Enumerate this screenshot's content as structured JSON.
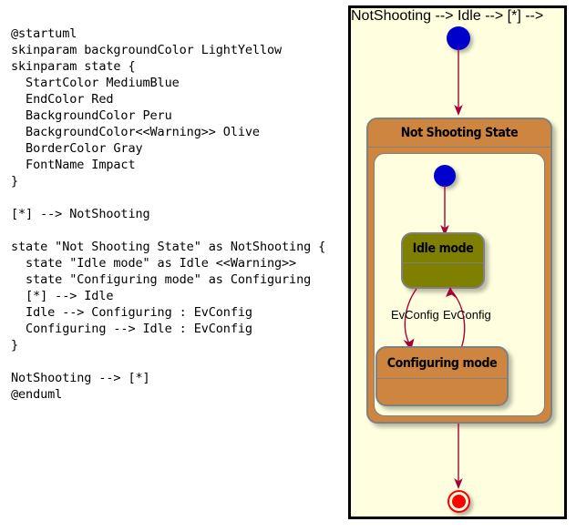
{
  "source": {
    "language": "plantuml",
    "code": "@startuml\nskinparam backgroundColor LightYellow\nskinparam state {\n  StartColor MediumBlue\n  EndColor Red\n  BackgroundColor Peru\n  BackgroundColor<<Warning>> Olive\n  BorderColor Gray\n  FontName Impact\n}\n\n[*] --> NotShooting\n\nstate \"Not Shooting State\" as NotShooting {\n  state \"Idle mode\" as Idle <<Warning>>\n  state \"Configuring mode\" as Configuring\n  [*] --> Idle\n  Idle --> Configuring : EvConfig\n  Configuring --> Idle : EvConfig\n}\n\nNotShooting --> [*]\n@enduml"
  },
  "diagram": {
    "type": "state-diagram",
    "background_color": "#FFFFE0",
    "border_color": "#000000",
    "colors": {
      "start": "#0000CD",
      "end": "#FF0000",
      "state_background": "#CD853F",
      "state_background_warning": "#808000",
      "state_border": "#808080",
      "arrow": "#A80036",
      "font": "Impact"
    },
    "nodes": {
      "start_outer": {
        "name": "initial-pseudo-state",
        "kind": "start"
      },
      "composite": {
        "name": "Not Shooting State",
        "alias": "NotShooting",
        "kind": "composite",
        "fill": "#CD853F"
      },
      "start_inner": {
        "name": "initial-pseudo-state-inner",
        "kind": "start"
      },
      "idle": {
        "name": "Idle mode",
        "alias": "Idle",
        "stereotype": "<<Warning>>",
        "kind": "state",
        "fill": "#808000"
      },
      "configuring": {
        "name": "Configuring mode",
        "alias": "Configuring",
        "kind": "state",
        "fill": "#CD853F"
      },
      "end_outer": {
        "name": "final-state",
        "kind": "end"
      }
    },
    "edges": [
      {
        "from": "[*]",
        "to": "NotShooting",
        "label": ""
      },
      {
        "from": "[*]",
        "to": "Idle",
        "label": ""
      },
      {
        "from": "Idle",
        "to": "Configuring",
        "label": "EvConfig"
      },
      {
        "from": "Configuring",
        "to": "Idle",
        "label": "EvConfig"
      },
      {
        "from": "NotShooting",
        "to": "[*]",
        "label": ""
      }
    ],
    "labels": {
      "composite_title": "Not Shooting State",
      "idle_title": "Idle mode",
      "configuring_title": "Configuring mode",
      "edge_idle_to_configuring": "EvConfig",
      "edge_configuring_to_idle": "EvConfig"
    }
  }
}
